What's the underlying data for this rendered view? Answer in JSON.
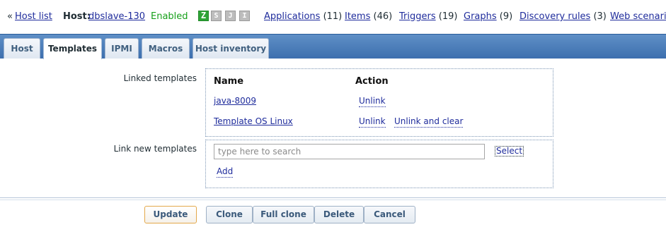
{
  "topbar": {
    "prefix": "«",
    "host_list": "Host list",
    "host_label": "Host:",
    "host_name": "dbslave-130",
    "status": "Enabled",
    "status_color": "#16a01a",
    "badges": [
      {
        "icon": "zabbix-agent-icon",
        "text": "Z"
      },
      {
        "icon": "snmp-icon",
        "text": "S"
      },
      {
        "icon": "jmx-icon",
        "text": "J"
      },
      {
        "icon": "ipmi-icon",
        "text": "I"
      }
    ],
    "nav": [
      {
        "label": "Applications",
        "count": "(11)"
      },
      {
        "label": "Items",
        "count": "(46)"
      },
      {
        "label": "Triggers",
        "count": "(19)"
      },
      {
        "label": "Graphs",
        "count": "(9)"
      },
      {
        "label": "Discovery rules",
        "count": "(3)"
      },
      {
        "label": "Web scenarios",
        "count": ""
      }
    ]
  },
  "tabs": [
    {
      "label": "Host"
    },
    {
      "label": "Templates",
      "active": true
    },
    {
      "label": "IPMI"
    },
    {
      "label": "Macros"
    },
    {
      "label": "Host inventory"
    }
  ],
  "form": {
    "linked_label": "Linked templates",
    "col_name": "Name",
    "col_action": "Action",
    "linked": [
      {
        "name": "java-8009",
        "unlink": "Unlink",
        "unlink_clear": ""
      },
      {
        "name": "Template OS Linux",
        "unlink": "Unlink",
        "unlink_clear": "Unlink and clear"
      }
    ],
    "link_new_label": "Link new templates",
    "search_placeholder": "type here to search",
    "select_label": "Select",
    "add_label": "Add"
  },
  "buttons": {
    "update": "Update",
    "clone": "Clone",
    "full_clone": "Full clone",
    "delete": "Delete",
    "cancel": "Cancel"
  }
}
